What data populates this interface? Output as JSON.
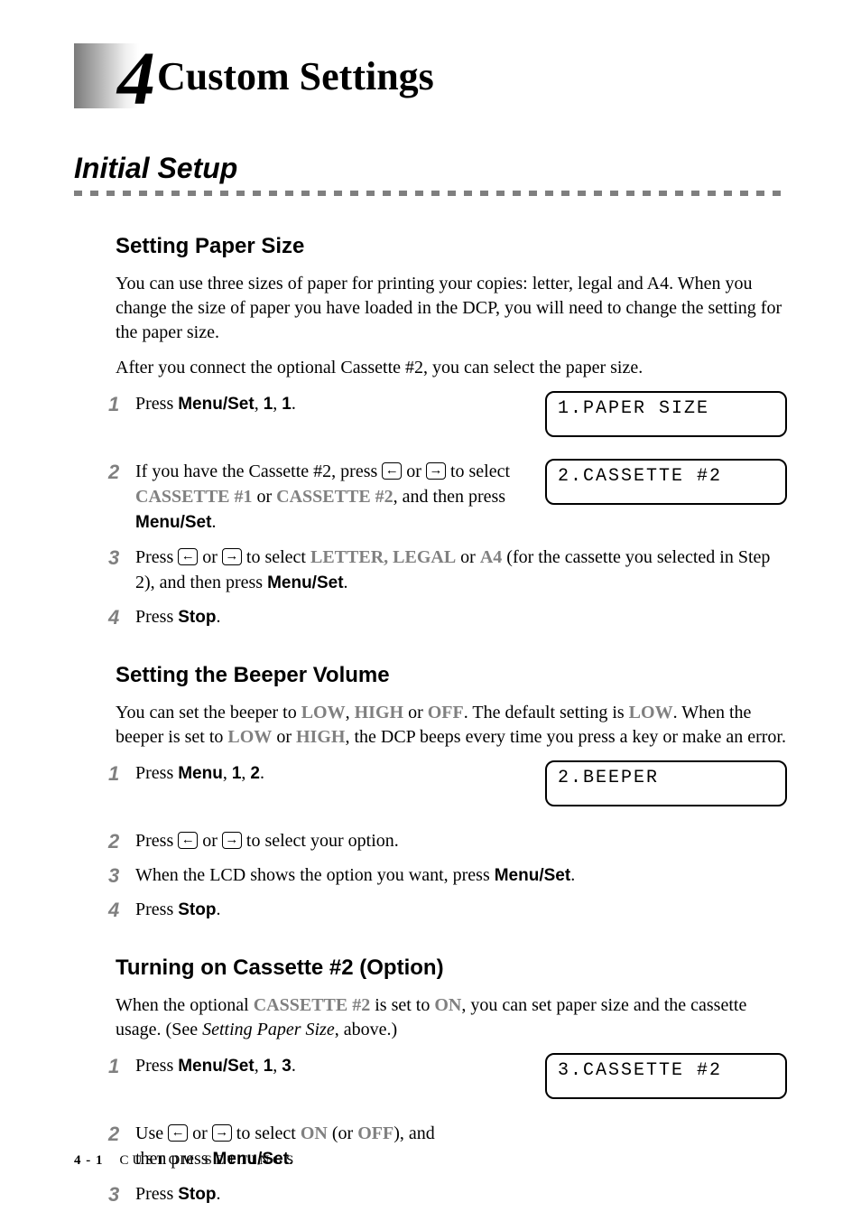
{
  "chapter": {
    "number": "4",
    "title": "Custom Settings"
  },
  "section_title": "Initial Setup",
  "paper_size": {
    "heading": "Setting Paper Size",
    "p1": "You can use three sizes of paper for printing your copies: letter, legal and A4. When you change the size of paper you have loaded in the DCP, you will need to change the setting for the paper size.",
    "p2": "After you connect the optional Cassette #2, you can select the paper size.",
    "step1_a": "Press ",
    "step1_b": "Menu/Set",
    "step1_c": ", ",
    "step1_d": "1",
    "step1_e": ", ",
    "step1_f": "1",
    "step1_g": ".",
    "lcd1": "1.PAPER SIZE",
    "step2_a": "If you have the Cassette #2, press ",
    "step2_b": " or ",
    "step2_c": " to select ",
    "step2_d": "CASSETTE #1",
    "step2_e": " or ",
    "step2_f": "CASSETTE #2",
    "step2_g": ", and then press ",
    "step2_h": "Menu/Set",
    "step2_i": ".",
    "lcd2": "2.CASSETTE #2",
    "step3_a": "Press ",
    "step3_b": " or ",
    "step3_c": " to select ",
    "step3_d": "LETTER, LEGAL",
    "step3_e": " or ",
    "step3_f": "A4",
    "step3_g": " (for the cassette you selected in Step 2), and then press ",
    "step3_h": "Menu/Set",
    "step3_i": ".",
    "step4_a": "Press ",
    "step4_b": "Stop",
    "step4_c": "."
  },
  "beeper": {
    "heading": "Setting the Beeper Volume",
    "p1_a": "You can set the beeper to ",
    "p1_b": "LOW",
    "p1_c": ", ",
    "p1_d": "HIGH",
    "p1_e": " or ",
    "p1_f": "OFF",
    "p1_g": ". The default setting is ",
    "p1_h": "LOW",
    "p1_i": ". When the beeper is set to ",
    "p1_j": "LOW",
    "p1_k": " or ",
    "p1_l": "HIGH",
    "p1_m": ", the DCP beeps every time you press a key or make an error.",
    "step1_a": "Press ",
    "step1_b": "Menu",
    "step1_c": ", ",
    "step1_d": "1",
    "step1_e": ", ",
    "step1_f": "2",
    "step1_g": ".",
    "lcd1": "2.BEEPER",
    "step2_a": "Press ",
    "step2_b": " or ",
    "step2_c": " to select your option.",
    "step3_a": "When the LCD shows the option you want, press ",
    "step3_b": "Menu/Set",
    "step3_c": ".",
    "step4_a": "Press ",
    "step4_b": "Stop",
    "step4_c": "."
  },
  "cassette2": {
    "heading": "Turning on Cassette #2 (Option)",
    "p1_a": "When the optional ",
    "p1_b": "CASSETTE #2",
    "p1_c": " is set to ",
    "p1_d": "ON",
    "p1_e": ", you can set paper size and the cassette usage. (See ",
    "p1_f": "Setting Paper Size",
    "p1_g": ", above.)",
    "step1_a": "Press ",
    "step1_b": "Menu/Set",
    "step1_c": ", ",
    "step1_d": "1",
    "step1_e": ", ",
    "step1_f": "3",
    "step1_g": ".",
    "lcd1": "3.CASSETTE #2",
    "step2_a": "Use ",
    "step2_b": " or ",
    "step2_c": " to select ",
    "step2_d": "ON",
    "step2_e": " (or ",
    "step2_f": "OFF",
    "step2_g": "), and then press ",
    "step2_h": "Menu/Set",
    "step2_i": ".",
    "step3_a": "Press ",
    "step3_b": "Stop",
    "step3_c": "."
  },
  "footer": {
    "page": "4 - 1",
    "label": "CUSTOM SETTINGS"
  },
  "arrows": {
    "left": "←",
    "right": "→"
  }
}
